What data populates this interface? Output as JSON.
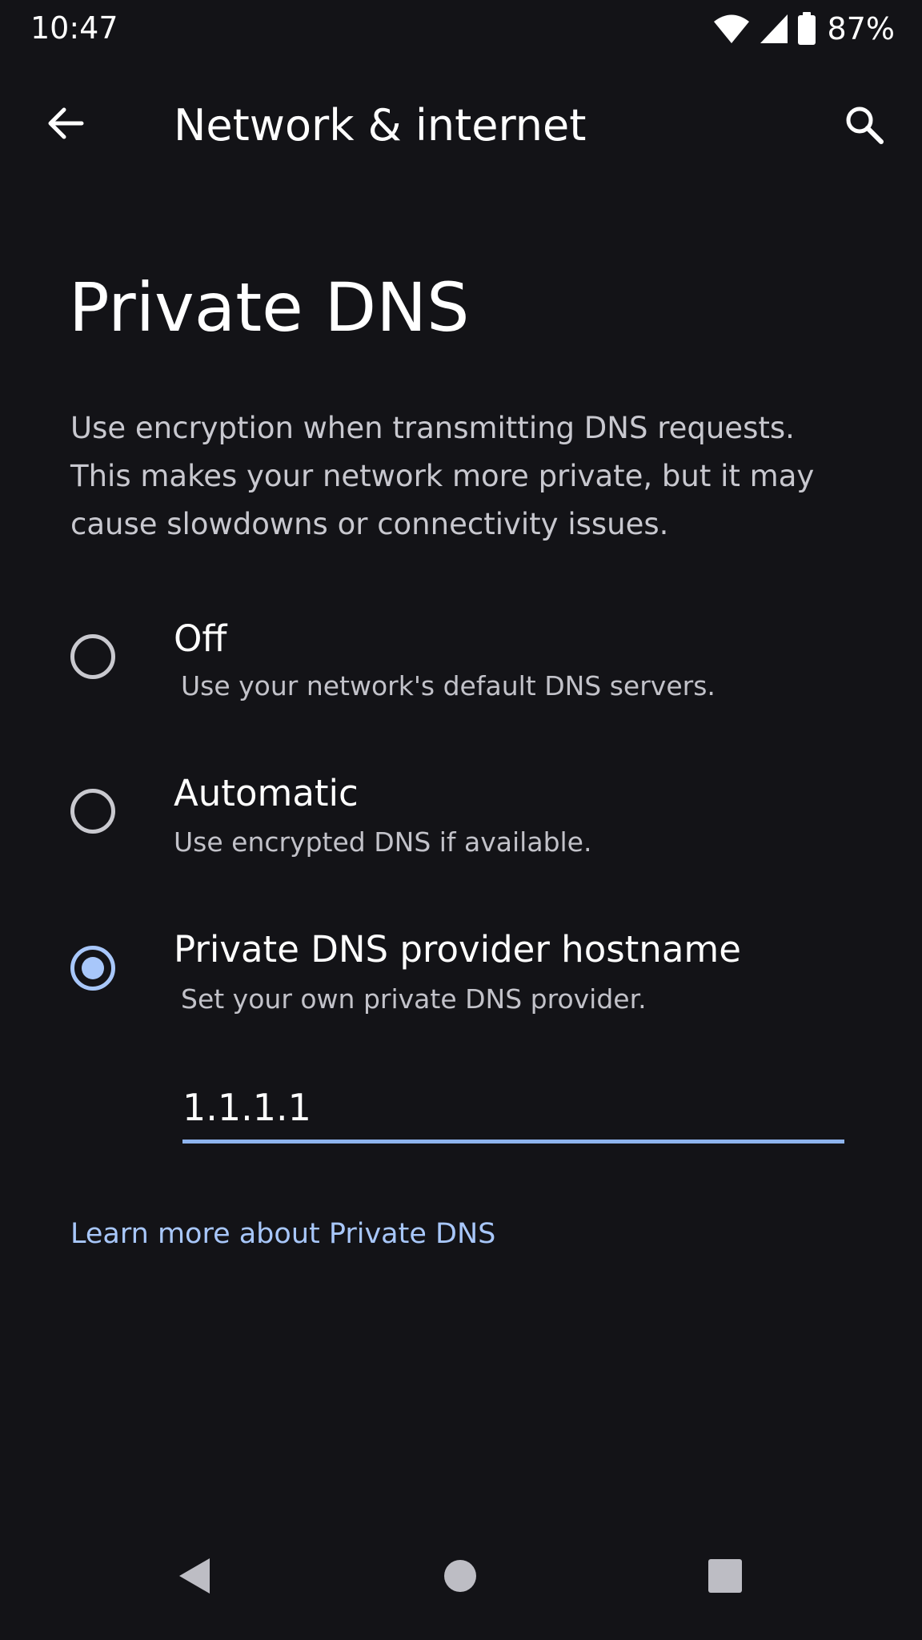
{
  "status_bar": {
    "time": "10:47",
    "battery_percent": "87%",
    "icons": [
      "wifi-icon",
      "cellular-signal-icon",
      "battery-icon"
    ]
  },
  "app_bar": {
    "title": "Network & internet",
    "back_icon": "arrow-back-icon",
    "search_icon": "search-icon"
  },
  "page": {
    "title": "Private DNS",
    "description": "Use encryption when transmitting DNS requests. This makes your network more private, but it may cause slowdowns or connectivity issues."
  },
  "options": [
    {
      "label": "Off",
      "summary": "Use your network's default DNS servers.",
      "selected": false
    },
    {
      "label": "Automatic",
      "summary": "Use encrypted DNS if available.",
      "selected": false
    },
    {
      "label": "Private DNS provider hostname",
      "summary": "Set your own private DNS provider.",
      "selected": true
    }
  ],
  "hostname_field": {
    "value": "1.1.1.1"
  },
  "learn_more": {
    "label": "Learn more about Private DNS"
  },
  "nav_bar": {
    "icons": [
      "nav-back-icon",
      "nav-home-icon",
      "nav-recents-icon"
    ]
  },
  "colors": {
    "background": "#131317",
    "accent": "#a8c7fa",
    "text_primary": "#ffffff",
    "text_secondary": "#c2c2c9"
  }
}
